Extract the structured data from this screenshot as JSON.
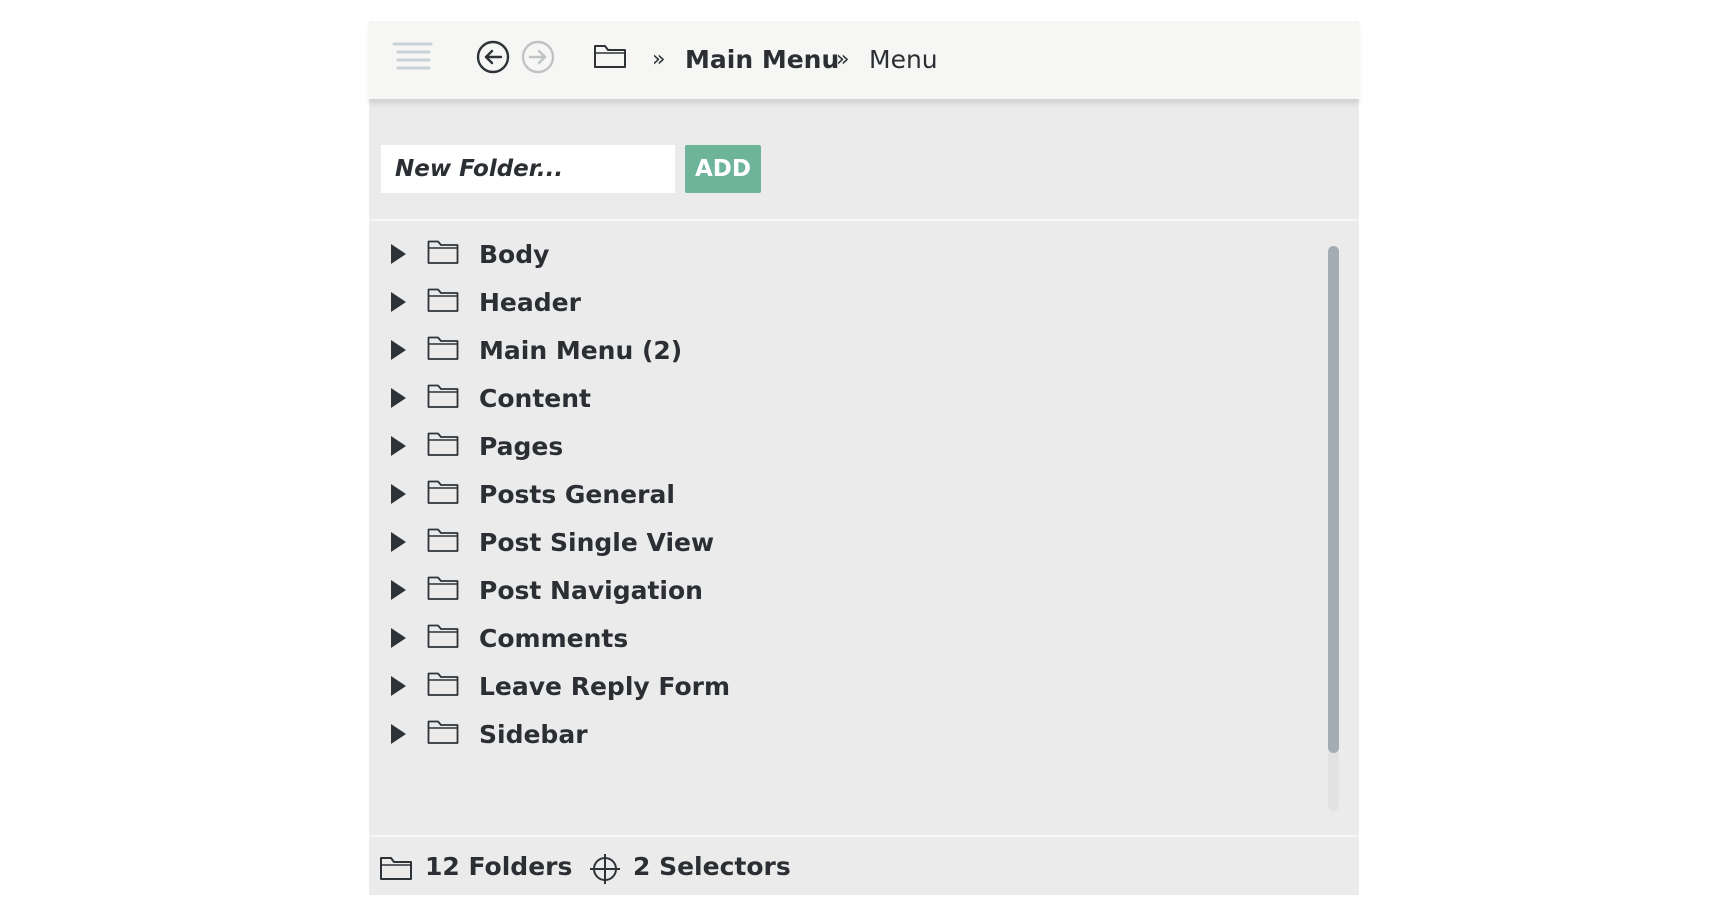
{
  "header": {
    "icons": {
      "menu": "list-menu-icon",
      "back": "back-arrow-circle-icon",
      "forward": "forward-arrow-circle-icon",
      "folder": "folder-icon"
    },
    "breadcrumb": {
      "separator": "»",
      "items": [
        "Main Menu",
        "Menu"
      ]
    }
  },
  "new_folder": {
    "placeholder": "New Folder...",
    "add_label": "ADD"
  },
  "tree": {
    "item_icon": "folder-icon",
    "expander_icon": "caret-right-icon",
    "items": [
      {
        "label": "Body"
      },
      {
        "label": "Header"
      },
      {
        "label": "Main Menu (2)"
      },
      {
        "label": "Content"
      },
      {
        "label": "Pages"
      },
      {
        "label": "Posts General"
      },
      {
        "label": "Post Single View"
      },
      {
        "label": "Post Navigation"
      },
      {
        "label": "Comments"
      },
      {
        "label": "Leave Reply Form"
      },
      {
        "label": "Sidebar"
      }
    ]
  },
  "footer": {
    "folders_label": "12  Folders",
    "selectors_label": "2  Selectors",
    "folder_icon": "folder-icon",
    "selector_icon": "crosshair-target-icon"
  },
  "colors": {
    "accent": "#6db49a",
    "panel_bg": "#ebebeb",
    "header_bg": "#f6f6f5",
    "text": "#2b2f33",
    "scrollbar_thumb": "#a5adb4"
  }
}
